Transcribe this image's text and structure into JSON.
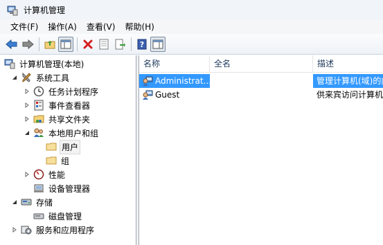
{
  "window": {
    "title": "计算机管理",
    "icon": "computer-management-icon"
  },
  "menu": [
    "文件(F)",
    "操作(A)",
    "查看(V)",
    "帮助(H)"
  ],
  "toolbar": {
    "buttons": [
      "back-arrow-icon",
      "forward-arrow-icon",
      "up-folder-icon",
      "show-tree-icon",
      "delete-x-icon",
      "properties-icon",
      "export-icon",
      "help-icon",
      "action-pane-icon"
    ]
  },
  "tree": {
    "root": "计算机管理(本地)",
    "system_tools": "系统工具",
    "task_scheduler": "任务计划程序",
    "event_viewer": "事件查看器",
    "shared_folders": "共享文件夹",
    "local_users_groups": "本地用户和组",
    "users": "用户",
    "groups": "组",
    "performance": "性能",
    "device_manager": "设备管理器",
    "storage": "存储",
    "disk_management": "磁盘管理",
    "services_apps": "服务和应用程序"
  },
  "list": {
    "columns": {
      "name": "名称",
      "fullname": "全名",
      "description": "描述"
    },
    "rows": [
      {
        "name": "Administrat...",
        "fullname": "",
        "description": "管理计算机(域)的内",
        "selected": true
      },
      {
        "name": "Guest",
        "fullname": "",
        "description": "供来宾访问计算机",
        "selected": false
      }
    ]
  },
  "colors": {
    "selection": "#3399ff",
    "header_text": "#1e395b",
    "title_bg": "#f1f5fa"
  }
}
